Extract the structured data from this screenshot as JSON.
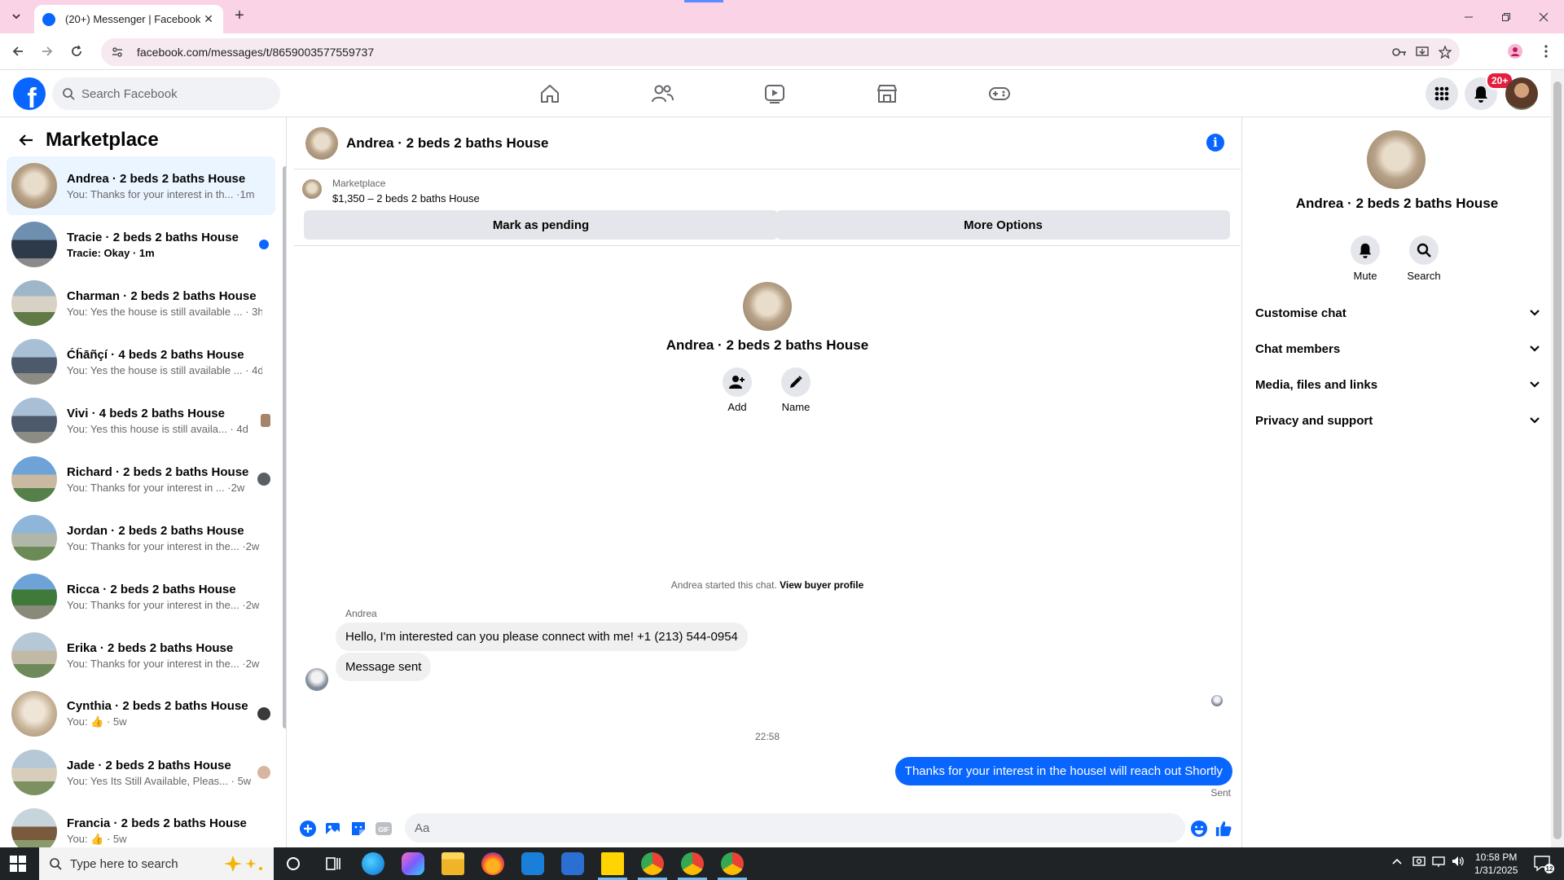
{
  "browser": {
    "tab_title": "(20+) Messenger | Facebook",
    "url": "facebook.com/messages/t/8659003577559737",
    "new_tab": "+",
    "tab_close": "✕"
  },
  "fb": {
    "logo": "f",
    "search_placeholder": "Search Facebook",
    "notification_badge": "20+",
    "brand_color": "#0866ff"
  },
  "sidebar": {
    "title": "Marketplace",
    "items": [
      {
        "name": "Andrea · 2 beds 2 baths House",
        "preview": "You: Thanks for your interest in th... ·1m",
        "active": true
      },
      {
        "name": "Tracie · 2 beds 2 baths House",
        "preview": "Tracie: Okay · 1m",
        "unread": true
      },
      {
        "name": "Charman · 2 beds 2 baths House",
        "preview": "You: Yes the house is still available ... · 3h"
      },
      {
        "name": "Ćĥāñçí · 4 beds 2 baths House",
        "preview": "You: Yes the house is still available ... · 4d"
      },
      {
        "name": "Vivi · 4 beds 2 baths House",
        "preview": "You: Yes this house is still availa... · 4d"
      },
      {
        "name": "Richard · 2 beds 2 baths House",
        "preview": "You: Thanks for your interest in ... ·2w"
      },
      {
        "name": "Jordan · 2 beds 2 baths House",
        "preview": "You: Thanks for your interest in the... ·2w"
      },
      {
        "name": "Ricca · 2 beds 2 baths House",
        "preview": "You: Thanks for your interest in the... ·2w"
      },
      {
        "name": "Erika · 2 beds 2 baths House",
        "preview": "You: Thanks for your interest in the... ·2w"
      },
      {
        "name": "Cynthia · 2 beds 2 baths House",
        "preview": "You: 👍 · 5w"
      },
      {
        "name": "Jade · 2 beds 2 baths House",
        "preview": "You: Yes Its Still Available, Pleas... · 5w"
      },
      {
        "name": "Francia · 2 beds 2 baths House",
        "preview": "You: 👍 · 5w"
      }
    ]
  },
  "conversation": {
    "title": "Andrea · 2 beds 2 baths House",
    "marketplace_label": "Marketplace",
    "listing": "$1,350 – 2 beds 2 baths House",
    "mark_pending": "Mark as pending",
    "more_options": "More Options",
    "intro_name": "Andrea · 2 beds 2 baths House",
    "add_label": "Add",
    "name_label": "Name",
    "started_text": "Andrea started this chat.",
    "view_buyer": "View buyer profile",
    "sender": "Andrea",
    "msg1": "Hello, I'm interested can you please connect with me! +1 (213) 544-0954",
    "msg2": "Message sent",
    "time": "22:58",
    "msg_out": "Thanks for your interest in the houseI will reach out Shortly",
    "sent": "Sent",
    "composer_placeholder": "Aa"
  },
  "details": {
    "name": "Andrea · 2 beds 2 baths House",
    "mute": "Mute",
    "search": "Search",
    "sections": [
      "Customise chat",
      "Chat members",
      "Media, files and links",
      "Privacy and support"
    ]
  },
  "taskbar": {
    "search_placeholder": "Type here to search",
    "time": "10:58 PM",
    "date": "1/31/2025",
    "notif_count": "12"
  }
}
